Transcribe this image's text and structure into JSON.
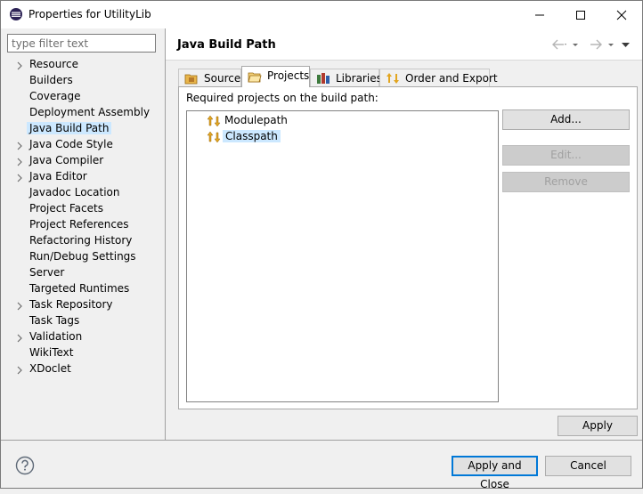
{
  "window": {
    "title": "Properties for UtilityLib",
    "icons": {
      "app": "eclipse-icon",
      "minimize": "minimize-icon",
      "maximize": "maximize-icon",
      "close": "close-icon"
    }
  },
  "filter": {
    "placeholder": "type filter text",
    "value": ""
  },
  "nav": {
    "items": [
      {
        "label": "Resource",
        "expandable": true,
        "selected": false
      },
      {
        "label": "Builders",
        "expandable": false,
        "selected": false
      },
      {
        "label": "Coverage",
        "expandable": false,
        "selected": false
      },
      {
        "label": "Deployment Assembly",
        "expandable": false,
        "selected": false
      },
      {
        "label": "Java Build Path",
        "expandable": false,
        "selected": true
      },
      {
        "label": "Java Code Style",
        "expandable": true,
        "selected": false
      },
      {
        "label": "Java Compiler",
        "expandable": true,
        "selected": false
      },
      {
        "label": "Java Editor",
        "expandable": true,
        "selected": false
      },
      {
        "label": "Javadoc Location",
        "expandable": false,
        "selected": false
      },
      {
        "label": "Project Facets",
        "expandable": false,
        "selected": false
      },
      {
        "label": "Project References",
        "expandable": false,
        "selected": false
      },
      {
        "label": "Refactoring History",
        "expandable": false,
        "selected": false
      },
      {
        "label": "Run/Debug Settings",
        "expandable": false,
        "selected": false
      },
      {
        "label": "Server",
        "expandable": false,
        "selected": false
      },
      {
        "label": "Targeted Runtimes",
        "expandable": false,
        "selected": false
      },
      {
        "label": "Task Repository",
        "expandable": true,
        "selected": false
      },
      {
        "label": "Task Tags",
        "expandable": false,
        "selected": false
      },
      {
        "label": "Validation",
        "expandable": true,
        "selected": false
      },
      {
        "label": "WikiText",
        "expandable": false,
        "selected": false
      },
      {
        "label": "XDoclet",
        "expandable": true,
        "selected": false
      }
    ]
  },
  "page": {
    "title": "Java Build Path",
    "icons": {
      "back": "back-arrow-icon",
      "forward": "forward-arrow-icon",
      "menu": "view-menu-icon"
    }
  },
  "tabs": [
    {
      "label": "Source",
      "icon": "source-folder-icon",
      "active": false
    },
    {
      "label": "Projects",
      "icon": "projects-folder-icon",
      "active": true
    },
    {
      "label": "Libraries",
      "icon": "libraries-icon",
      "active": false
    },
    {
      "label": "Order and Export",
      "icon": "order-export-icon",
      "active": false
    }
  ],
  "projects_panel": {
    "section_label": "Required projects on the build path:",
    "items": [
      {
        "label": "Modulepath",
        "icon": "modulepath-icon",
        "selected": false
      },
      {
        "label": "Classpath",
        "icon": "classpath-icon",
        "selected": true
      }
    ],
    "buttons": {
      "add": "Add...",
      "edit": "Edit...",
      "remove": "Remove"
    }
  },
  "footer": {
    "apply": "Apply",
    "apply_and_close": "Apply and Close",
    "cancel": "Cancel",
    "help_icon": "help-icon"
  },
  "colors": {
    "selection": "#cce8ff",
    "focus_border": "#0078d7",
    "window_bg": "#f0f0f0"
  }
}
